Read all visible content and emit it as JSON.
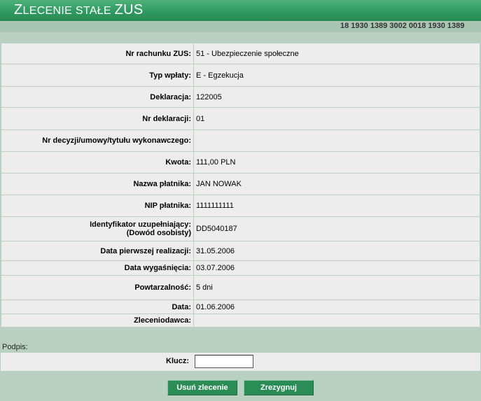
{
  "header": {
    "title_big": "Z",
    "title_small": "LECENIE STAŁE ",
    "title_rest": "ZUS"
  },
  "account_number": "18 1930 1389 3002 0018 1930 1389",
  "rows": [
    {
      "label": "Nr rachunku ZUS:",
      "value": "51 - Ubezpieczenie społeczne",
      "h": 30
    },
    {
      "label": "Typ wpłaty:",
      "value": "E - Egzekucja",
      "h": 32
    },
    {
      "label": "Deklaracja:",
      "value": "122005",
      "h": 30
    },
    {
      "label": "Nr deklaracji:",
      "value": "01",
      "h": 32
    },
    {
      "label": "Nr decyzji/umowy/tytułu wykonawczego:",
      "value": "",
      "h": 31
    },
    {
      "label": "Kwota:",
      "value": "111,00 PLN",
      "h": 31
    },
    {
      "label": "Nazwa płatnika:",
      "value": "JAN NOWAK",
      "h": 31
    },
    {
      "label": "NIP płatnika:",
      "value": "1111111111",
      "h": 31
    },
    {
      "label": "Identyfikator uzupełniający:\n(Dowód osobisty)",
      "value": "DD5040187",
      "h": 35
    },
    {
      "label": "Data pierwszej realizacji:",
      "value": "31.05.2006",
      "h": 28
    },
    {
      "label": "Data wygaśnięcia:",
      "value": "03.07.2006",
      "h": 21
    },
    {
      "label": "Powtarzalność:",
      "value": "5 dni",
      "h": 35
    },
    {
      "label": "Data:",
      "value": "01.06.2006",
      "h": 20
    },
    {
      "label": "Zleceniodawca:",
      "value": "",
      "h": 19
    }
  ],
  "signature": {
    "label": "Podpis:",
    "key_label": "Klucz:",
    "key_value": ""
  },
  "buttons": {
    "delete": "Usuń zlecenie",
    "cancel": "Zrezygnuj"
  }
}
